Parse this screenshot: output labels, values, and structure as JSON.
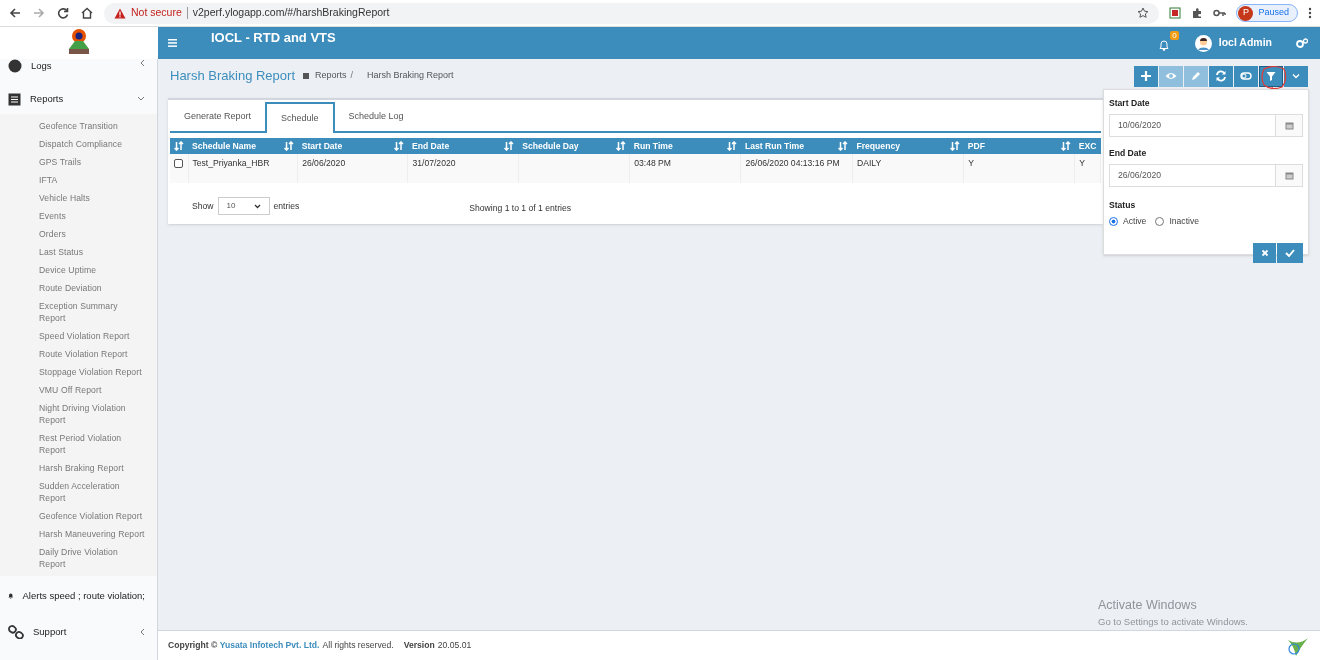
{
  "browser": {
    "security_label": "Not secure",
    "url": "v2perf.ylogapp.com/#/harshBrakingReport",
    "profile_initial": "P",
    "profile_status": "Paused"
  },
  "header": {
    "title": "IOCL - RTD and VTS",
    "notification_count": "0",
    "user_name": "Iocl Admin"
  },
  "sidebar": {
    "items": [
      {
        "label": "Logs",
        "expanded": false
      },
      {
        "label": "Reports",
        "expanded": true,
        "children": [
          {
            "label": "Geofence Transition"
          },
          {
            "label": "Dispatch Compliance"
          },
          {
            "label": "GPS Trails"
          },
          {
            "label": "IFTA"
          },
          {
            "label": "Vehicle Halts"
          },
          {
            "label": "Events"
          },
          {
            "label": "Orders"
          },
          {
            "label": "Last Status"
          },
          {
            "label": "Device Uptime"
          },
          {
            "label": "Route Deviation"
          },
          {
            "label": "Exception Summary Report"
          },
          {
            "label": "Speed Violation Report"
          },
          {
            "label": "Route Violation Report"
          },
          {
            "label": "Stoppage Violation Report"
          },
          {
            "label": "VMU Off Report"
          },
          {
            "label": "Night Driving Violation Report"
          },
          {
            "label": "Rest Period Violation Report"
          },
          {
            "label": "Harsh Braking Report"
          },
          {
            "label": "Sudden Acceleration Report"
          },
          {
            "label": "Geofence Violation Report"
          },
          {
            "label": "Harsh Maneuvering Report"
          },
          {
            "label": "Daily Drive Violation Report"
          }
        ]
      },
      {
        "label": "Alerts speed ; route violation;"
      },
      {
        "label": "Support",
        "expanded": false
      }
    ]
  },
  "page": {
    "title": "Harsh Braking Report",
    "breadcrumb": [
      "Reports",
      "Harsh Braking Report"
    ],
    "breadcrumb_separator": "/"
  },
  "toolbar": [
    {
      "disabled": false,
      "selected": false
    },
    {
      "disabled": true,
      "selected": false
    },
    {
      "disabled": true,
      "selected": false
    },
    {
      "disabled": false,
      "selected": false
    },
    {
      "disabled": false,
      "selected": false
    },
    {
      "disabled": false,
      "selected": true
    },
    {
      "disabled": false,
      "selected": false
    }
  ],
  "tabs": [
    {
      "label": "Generate Report",
      "selected": false
    },
    {
      "label": "Schedule",
      "selected": true
    },
    {
      "label": "Schedule Log",
      "selected": false
    }
  ],
  "table": {
    "columns": [
      "Schedule Name",
      "Start Date",
      "End Date",
      "Schedule Day",
      "Run Time",
      "Last Run Time",
      "Frequency",
      "PDF",
      "EXC"
    ],
    "rows": [
      {
        "checked": false,
        "cells": [
          "Test_Priyanka_HBR",
          "26/06/2020",
          "31/07/2020",
          "",
          "03:48 PM",
          "26/06/2020 04:13:16 PM",
          "DAILY",
          "Y",
          "Y"
        ]
      }
    ]
  },
  "pagination": {
    "show_label": "Show",
    "page_size": "10",
    "entries_label": "entries",
    "info": "Showing 1 to 1 of 1 entries"
  },
  "filter_panel": {
    "start_date_label": "Start Date",
    "start_date": "10/06/2020",
    "end_date_label": "End Date",
    "end_date": "26/06/2020",
    "status_label": "Status",
    "status_options": [
      {
        "label": "Active",
        "selected": true
      },
      {
        "label": "Inactive",
        "selected": false
      }
    ]
  },
  "footer": {
    "copyright": "**Copyright ©** ",
    "company": "Yusata Infotech Pvt. Ltd.",
    "rights": "All rights reserved.",
    "version_label": "Version",
    "version": "20.05.01"
  },
  "os_notice": {
    "title": "Activate Windows",
    "subtitle": "Go to Settings to activate Windows."
  }
}
